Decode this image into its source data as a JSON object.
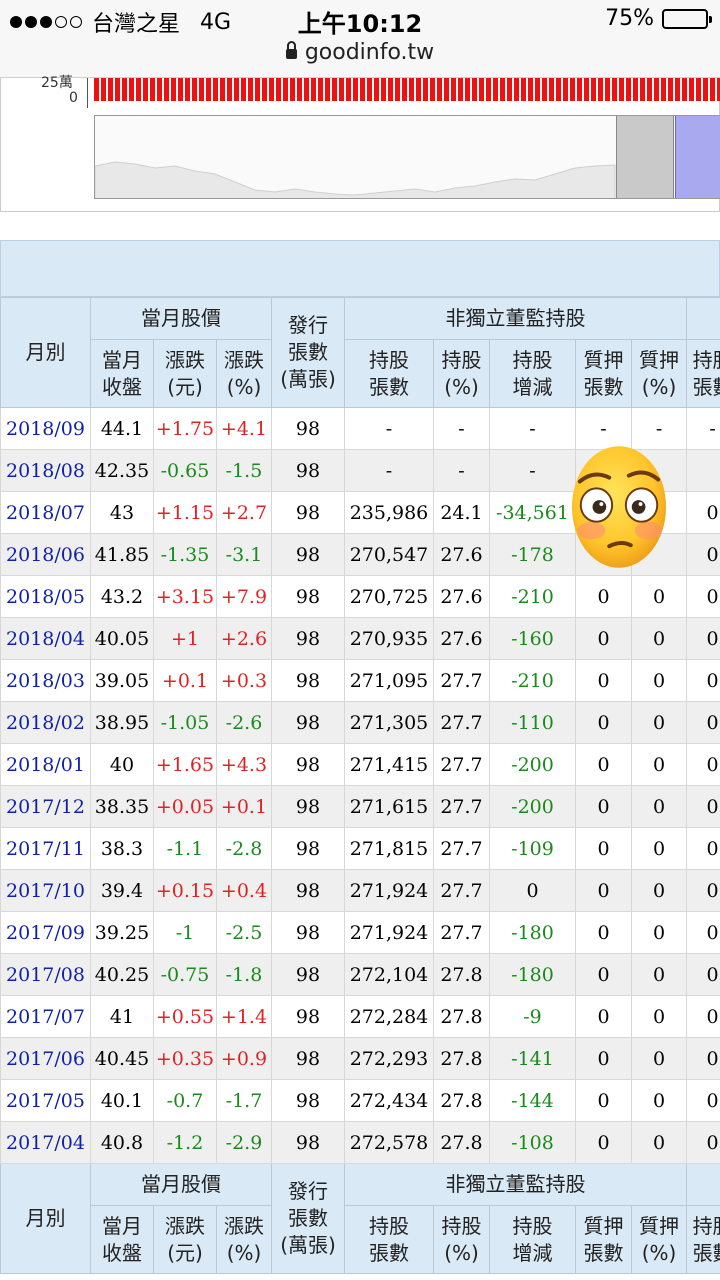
{
  "status_bar": {
    "carrier": "台灣之星",
    "network": "4G",
    "time": "上午10:12",
    "battery": "75%",
    "url": "goodinfo.tw"
  },
  "chart": {
    "y_label_top": "25萬",
    "y_label_zero": "0"
  },
  "table": {
    "headers": {
      "month": "月別",
      "price_group": "當月股價",
      "close": [
        "當月",
        "收盤"
      ],
      "change": [
        "漲跌",
        "(元)"
      ],
      "change_pct": [
        "漲跌",
        "(%)"
      ],
      "issued": [
        "發行",
        "張數",
        "(萬張)"
      ],
      "holding_group": "非獨立董監持股",
      "hold_shares": [
        "持股",
        "張數"
      ],
      "hold_pct": [
        "持股",
        "(%)"
      ],
      "hold_change": [
        "持股",
        "增減"
      ],
      "pledge_shares": [
        "質押",
        "張數"
      ],
      "pledge_pct": [
        "質押",
        "(%)"
      ],
      "cut_col": [
        "持股",
        "張數"
      ]
    },
    "rows": [
      {
        "month": "2018/09",
        "close": "44.1",
        "chg": "+1.75",
        "pct": "+4.1",
        "issued": "98",
        "shares": "-",
        "hpct": "-",
        "delta": "-",
        "pledge": "-",
        "ppct": "-",
        "next": "-"
      },
      {
        "month": "2018/08",
        "close": "42.35",
        "chg": "-0.65",
        "pct": "-1.5",
        "issued": "98",
        "shares": "-",
        "hpct": "-",
        "delta": "-",
        "pledge": "",
        "ppct": "",
        "next": ""
      },
      {
        "month": "2018/07",
        "close": "43",
        "chg": "+1.15",
        "pct": "+2.7",
        "issued": "98",
        "shares": "235,986",
        "hpct": "24.1",
        "delta": "-34,561",
        "pledge": "",
        "ppct": "",
        "next": "0"
      },
      {
        "month": "2018/06",
        "close": "41.85",
        "chg": "-1.35",
        "pct": "-3.1",
        "issued": "98",
        "shares": "270,547",
        "hpct": "27.6",
        "delta": "-178",
        "pledge": "",
        "ppct": "",
        "next": "0"
      },
      {
        "month": "2018/05",
        "close": "43.2",
        "chg": "+3.15",
        "pct": "+7.9",
        "issued": "98",
        "shares": "270,725",
        "hpct": "27.6",
        "delta": "-210",
        "pledge": "0",
        "ppct": "0",
        "next": "0"
      },
      {
        "month": "2018/04",
        "close": "40.05",
        "chg": "+1",
        "pct": "+2.6",
        "issued": "98",
        "shares": "270,935",
        "hpct": "27.6",
        "delta": "-160",
        "pledge": "0",
        "ppct": "0",
        "next": "0"
      },
      {
        "month": "2018/03",
        "close": "39.05",
        "chg": "+0.1",
        "pct": "+0.3",
        "issued": "98",
        "shares": "271,095",
        "hpct": "27.7",
        "delta": "-210",
        "pledge": "0",
        "ppct": "0",
        "next": "0"
      },
      {
        "month": "2018/02",
        "close": "38.95",
        "chg": "-1.05",
        "pct": "-2.6",
        "issued": "98",
        "shares": "271,305",
        "hpct": "27.7",
        "delta": "-110",
        "pledge": "0",
        "ppct": "0",
        "next": "0"
      },
      {
        "month": "2018/01",
        "close": "40",
        "chg": "+1.65",
        "pct": "+4.3",
        "issued": "98",
        "shares": "271,415",
        "hpct": "27.7",
        "delta": "-200",
        "pledge": "0",
        "ppct": "0",
        "next": "0"
      },
      {
        "month": "2017/12",
        "close": "38.35",
        "chg": "+0.05",
        "pct": "+0.1",
        "issued": "98",
        "shares": "271,615",
        "hpct": "27.7",
        "delta": "-200",
        "pledge": "0",
        "ppct": "0",
        "next": "0"
      },
      {
        "month": "2017/11",
        "close": "38.3",
        "chg": "-1.1",
        "pct": "-2.8",
        "issued": "98",
        "shares": "271,815",
        "hpct": "27.7",
        "delta": "-109",
        "pledge": "0",
        "ppct": "0",
        "next": "0"
      },
      {
        "month": "2017/10",
        "close": "39.4",
        "chg": "+0.15",
        "pct": "+0.4",
        "issued": "98",
        "shares": "271,924",
        "hpct": "27.7",
        "delta": "0",
        "pledge": "0",
        "ppct": "0",
        "next": "0"
      },
      {
        "month": "2017/09",
        "close": "39.25",
        "chg": "-1",
        "pct": "-2.5",
        "issued": "98",
        "shares": "271,924",
        "hpct": "27.7",
        "delta": "-180",
        "pledge": "0",
        "ppct": "0",
        "next": "0"
      },
      {
        "month": "2017/08",
        "close": "40.25",
        "chg": "-0.75",
        "pct": "-1.8",
        "issued": "98",
        "shares": "272,104",
        "hpct": "27.8",
        "delta": "-180",
        "pledge": "0",
        "ppct": "0",
        "next": "0"
      },
      {
        "month": "2017/07",
        "close": "41",
        "chg": "+0.55",
        "pct": "+1.4",
        "issued": "98",
        "shares": "272,284",
        "hpct": "27.8",
        "delta": "-9",
        "pledge": "0",
        "ppct": "0",
        "next": "0"
      },
      {
        "month": "2017/06",
        "close": "40.45",
        "chg": "+0.35",
        "pct": "+0.9",
        "issued": "98",
        "shares": "272,293",
        "hpct": "27.8",
        "delta": "-141",
        "pledge": "0",
        "ppct": "0",
        "next": "0"
      },
      {
        "month": "2017/05",
        "close": "40.1",
        "chg": "-0.7",
        "pct": "-1.7",
        "issued": "98",
        "shares": "272,434",
        "hpct": "27.8",
        "delta": "-144",
        "pledge": "0",
        "ppct": "0",
        "next": "0"
      },
      {
        "month": "2017/04",
        "close": "40.8",
        "chg": "-1.2",
        "pct": "-2.9",
        "issued": "98",
        "shares": "272,578",
        "hpct": "27.8",
        "delta": "-108",
        "pledge": "0",
        "ppct": "0",
        "next": "0"
      }
    ]
  },
  "overlay": {
    "emoji": "flushed-face"
  },
  "colors": {
    "month_link": "#1122aa",
    "up": "#e02222",
    "down": "#1a8a1a",
    "header_bg": "#d9e9f6",
    "even_row_bg": "#efefef"
  }
}
